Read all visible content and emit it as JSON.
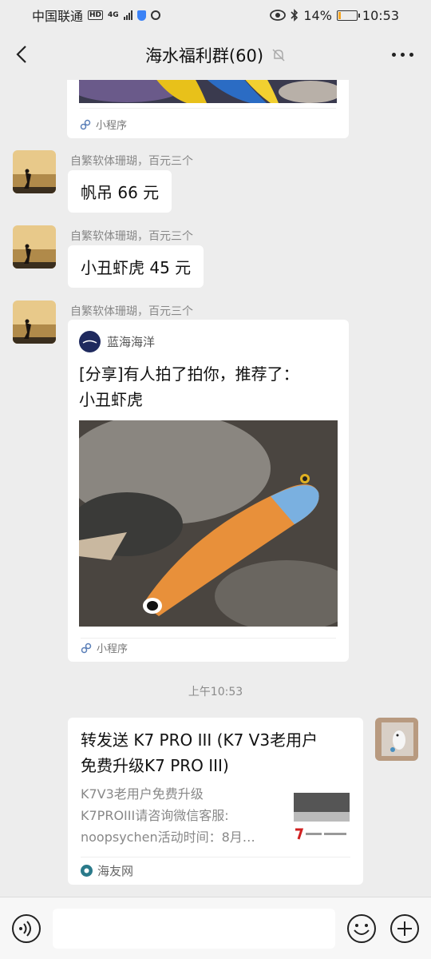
{
  "status_bar": {
    "carrier": "中国联通",
    "hd": "HD",
    "network": "4G",
    "battery_pct": "14%",
    "battery_level": 0.14,
    "time": "10:53"
  },
  "title_bar": {
    "title": "海水福利群(60)"
  },
  "messages": {
    "mini1": {
      "footer": "小程序"
    },
    "m1": {
      "sender": "自繁软体珊瑚，百元三个",
      "text": "帆吊 66 元"
    },
    "m2": {
      "sender": "自繁软体珊瑚，百元三个",
      "text": "小丑虾虎 45 元"
    },
    "m3": {
      "sender": "自繁软体珊瑚，百元三个",
      "source": "蓝海海洋",
      "title_line1": "[分享]有人拍了拍你，推荐了：",
      "title_line2": "小丑虾虎",
      "footer": "小程序"
    },
    "timestamp": "上午10:53",
    "m4": {
      "title_line1": "转发送 K7 PRO III (K7 V3老用户",
      "title_line2": "免费升级K7 PRO III)",
      "desc_line1": "K7V3老用户免费升级",
      "desc_line2": "K7PROIII请咨询微信客服:",
      "desc_line3": "noopsychen活动时间：8月…",
      "footer": "海友网"
    }
  },
  "colors": {
    "chat_bg": "#ededed",
    "bubble_bg": "#ffffff",
    "muted_text": "#888888",
    "battery": "#f5a623"
  }
}
